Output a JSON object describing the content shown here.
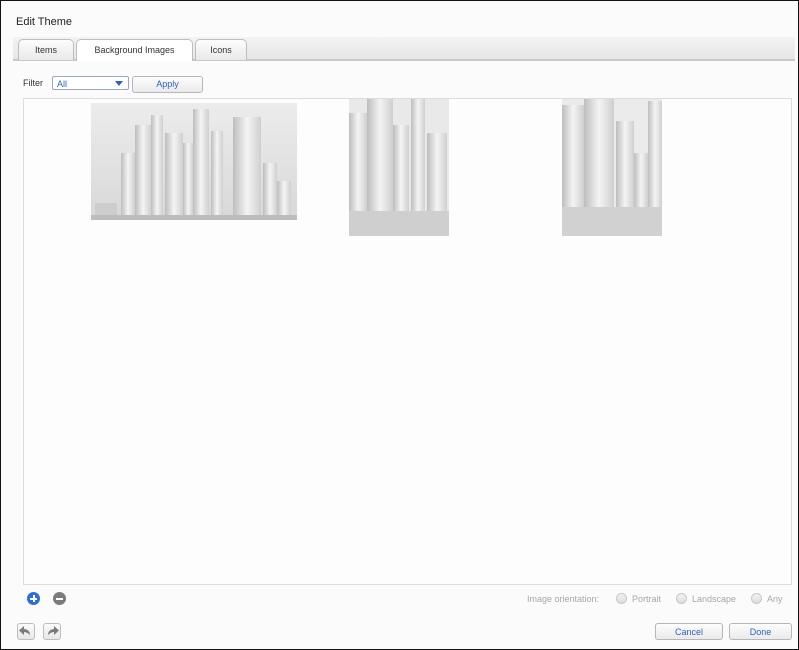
{
  "window": {
    "title": "Edit Theme"
  },
  "tabs": [
    {
      "label": "Items"
    },
    {
      "label": "Background Images",
      "active": true
    },
    {
      "label": "Icons"
    }
  ],
  "filter": {
    "label": "Filter",
    "selected": "All",
    "apply_label": "Apply"
  },
  "gallery": {
    "images": [
      {
        "name": "city-skyline-landscape",
        "orientation": "landscape"
      },
      {
        "name": "city-skyline-portrait-1",
        "orientation": "portrait"
      },
      {
        "name": "city-skyline-portrait-2",
        "orientation": "portrait"
      }
    ]
  },
  "orientation": {
    "label": "Image orientation:",
    "options": [
      "Portrait",
      "Landscape",
      "Any"
    ]
  },
  "footer": {
    "cancel_label": "Cancel",
    "done_label": "Done"
  },
  "icons": {
    "add": "plus-circle-icon",
    "remove": "minus-circle-icon",
    "undo": "undo-arrow-icon",
    "redo": "redo-arrow-icon"
  },
  "colors": {
    "accent": "#2b6ee0",
    "link_text": "#2d5fc7"
  }
}
